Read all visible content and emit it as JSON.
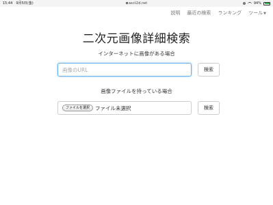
{
  "status_bar": {
    "time": "15:44",
    "date": "9月5日(金)",
    "url": "ascii2d.net",
    "battery": "94%"
  },
  "nav": {
    "items": [
      "説明",
      "最近の検索",
      "ランキング",
      "ツール"
    ]
  },
  "page": {
    "title": "二次元画像詳細検索",
    "url_section_label": "インターネットに画像がある場合",
    "url_placeholder": "画像のURL",
    "url_search_button": "検索",
    "file_section_label": "画像ファイルを持っている場合",
    "file_choose_button": "ファイルを選択",
    "file_status": "ファイル未選択",
    "file_search_button": "検索"
  },
  "colors": {
    "focus_border": "#66afe9",
    "battery_fill": "#2db84d"
  }
}
